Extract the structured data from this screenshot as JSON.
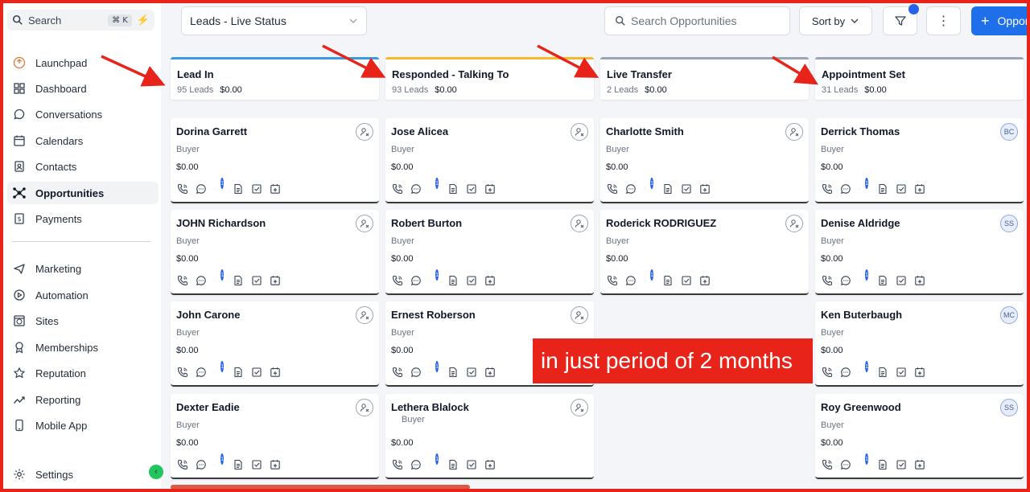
{
  "sidebar": {
    "search_label": "Search",
    "search_shortcut": "⌘ K",
    "items": [
      {
        "label": "Launchpad",
        "icon": "launchpad-icon"
      },
      {
        "label": "Dashboard",
        "icon": "dashboard-icon"
      },
      {
        "label": "Conversations",
        "icon": "chat-icon"
      },
      {
        "label": "Calendars",
        "icon": "calendar-icon"
      },
      {
        "label": "Contacts",
        "icon": "contacts-icon"
      },
      {
        "label": "Opportunities",
        "icon": "opportunities-icon",
        "active": true
      },
      {
        "label": "Payments",
        "icon": "payments-icon"
      },
      {
        "label": "Marketing",
        "icon": "marketing-icon"
      },
      {
        "label": "Automation",
        "icon": "automation-icon"
      },
      {
        "label": "Sites",
        "icon": "sites-icon"
      },
      {
        "label": "Memberships",
        "icon": "memberships-icon"
      },
      {
        "label": "Reputation",
        "icon": "star-icon"
      },
      {
        "label": "Reporting",
        "icon": "reporting-icon"
      },
      {
        "label": "Mobile App",
        "icon": "mobile-icon"
      },
      {
        "label": "Settings",
        "icon": "gear-icon"
      }
    ]
  },
  "toolbar": {
    "pipeline": "Leads - Live Status",
    "search_placeholder": "Search Opportunities",
    "sort_label": "Sort by",
    "add_label": "Oppor"
  },
  "columns": [
    {
      "title": "Lead In",
      "count": "95 Leads",
      "amount": "$0.00",
      "accent": "#3b9ae1",
      "cards": [
        {
          "name": "Dorina Garrett",
          "role": "Buyer",
          "value": "$0.00",
          "badge": "1"
        },
        {
          "name": "JOHN Richardson",
          "role": "Buyer",
          "value": "$0.00",
          "badge": "1"
        },
        {
          "name": "John Carone",
          "role": "Buyer",
          "value": "$0.00",
          "badge": "1"
        },
        {
          "name": "Dexter Eadie",
          "role": "Buyer",
          "value": "$0.00",
          "badge": "1"
        }
      ]
    },
    {
      "title": "Responded - Talking To",
      "count": "93 Leads",
      "amount": "$0.00",
      "accent": "#f5b82e",
      "cards": [
        {
          "name": "Jose Alicea",
          "role": "Buyer",
          "value": "$0.00",
          "badge": "1"
        },
        {
          "name": "Robert Burton",
          "role": "Buyer",
          "value": "$0.00",
          "badge": "1"
        },
        {
          "name": "Ernest Roberson",
          "role": "Buyer",
          "value": "$0.00",
          "badge": "1"
        },
        {
          "name": "Lethera Blalock",
          "role": "Buyer",
          "value": "$0.00",
          "badge": "1"
        }
      ]
    },
    {
      "title": "Live Transfer",
      "count": "2 Leads",
      "amount": "$0.00",
      "accent": "#9aa5b8",
      "cards": [
        {
          "name": "Charlotte Smith",
          "role": "Buyer",
          "value": "$0.00",
          "badge": "1"
        },
        {
          "name": "Roderick RODRIGUEZ",
          "role": "Buyer",
          "value": "$0.00",
          "badge": "1"
        }
      ]
    },
    {
      "title": "Appointment Set",
      "count": "31 Leads",
      "amount": "$0.00",
      "accent": "#9aa5b8",
      "cards": [
        {
          "name": "Derrick Thomas",
          "role": "Buyer",
          "value": "$0.00",
          "badge": "1",
          "initials": "BC"
        },
        {
          "name": "Denise Aldridge",
          "role": "Buyer",
          "value": "$0.00",
          "badge": "1",
          "initials": "SS"
        },
        {
          "name": "Ken Buterbaugh",
          "role": "Buyer",
          "value": "$0.00",
          "badge": "1",
          "initials": "MC"
        },
        {
          "name": "Roy Greenwood",
          "role": "Buyer",
          "value": "$0.00",
          "badge": "1",
          "initials": "SS"
        }
      ]
    }
  ],
  "overlay_text": "in just period of 2 months",
  "colors": {
    "accent": "#1f6feb",
    "annotation": "#e8231a"
  }
}
